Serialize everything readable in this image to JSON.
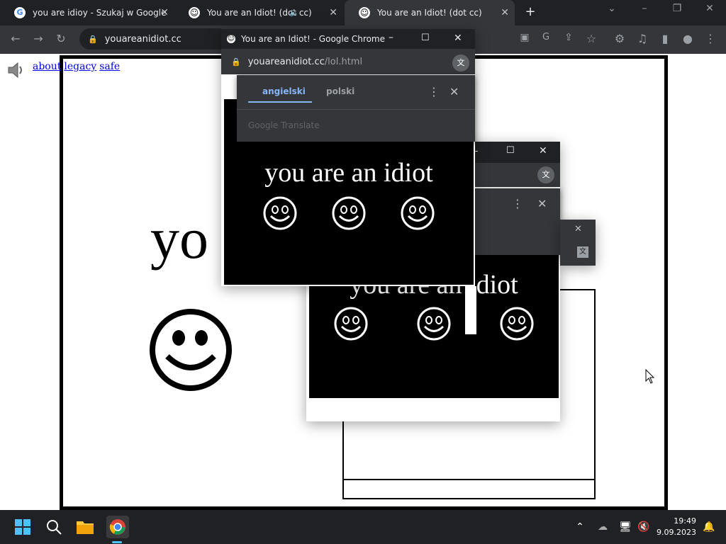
{
  "tabs": [
    {
      "title": "you are idioy - Szukaj w Google"
    },
    {
      "title": "You are an Idiot! (dot cc)"
    },
    {
      "title": "You are an Idiot! (dot cc)"
    }
  ],
  "address": {
    "url": "youareanidiot.cc"
  },
  "page": {
    "links": [
      "about",
      "legacy",
      "safe"
    ],
    "big_text": "yo"
  },
  "popup": {
    "title": "You are an Idiot! - Google Chrome",
    "url_host": "youareanidiot.cc",
    "url_path": "/lol.html",
    "translate": {
      "lang_a": "angielski",
      "lang_b": "polski",
      "brand": "Google Translate"
    },
    "text": "you are an idiot"
  },
  "popup2": {
    "text": "you are an idiot"
  },
  "clock": {
    "time": "19:49",
    "date": "9.09.2023"
  },
  "colors": {
    "chrome_dark": "#202124",
    "chrome_mid": "#35363a",
    "accent": "#8ab4f8"
  }
}
